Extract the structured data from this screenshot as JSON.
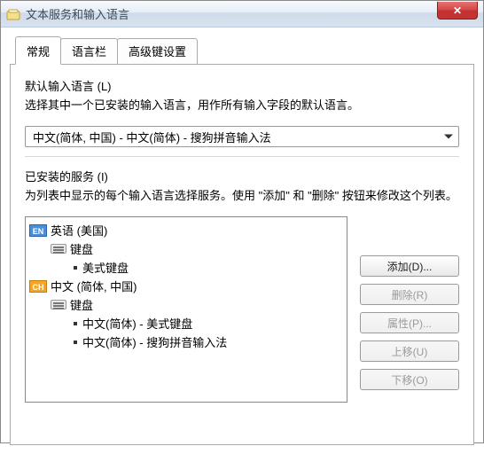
{
  "window": {
    "title": "文本服务和输入语言",
    "close_icon": "✕"
  },
  "tabs": [
    {
      "label": "常规",
      "active": true
    },
    {
      "label": "语言栏",
      "active": false
    },
    {
      "label": "高级键设置",
      "active": false
    }
  ],
  "default_lang": {
    "title": "默认输入语言 (L)",
    "desc": "选择其中一个已安装的输入语言，用作所有输入字段的默认语言。",
    "selected": "中文(简体, 中国) - 中文(简体) - 搜狗拼音输入法"
  },
  "installed": {
    "title": "已安装的服务 (I)",
    "desc": "为列表中显示的每个输入语言选择服务。使用 \"添加\" 和 \"删除\" 按钮来修改这个列表。"
  },
  "tree": {
    "en": {
      "badge": "EN",
      "label": "英语 (美国)",
      "keyboard_label": "键盘",
      "items": [
        "美式键盘"
      ]
    },
    "ch": {
      "badge": "CH",
      "label": "中文 (简体, 中国)",
      "keyboard_label": "键盘",
      "items": [
        "中文(简体) - 美式键盘",
        "中文(简体) - 搜狗拼音输入法"
      ]
    }
  },
  "buttons": {
    "add": "添加(D)...",
    "remove": "删除(R)",
    "properties": "属性(P)...",
    "moveup": "上移(U)",
    "movedown": "下移(O)"
  }
}
